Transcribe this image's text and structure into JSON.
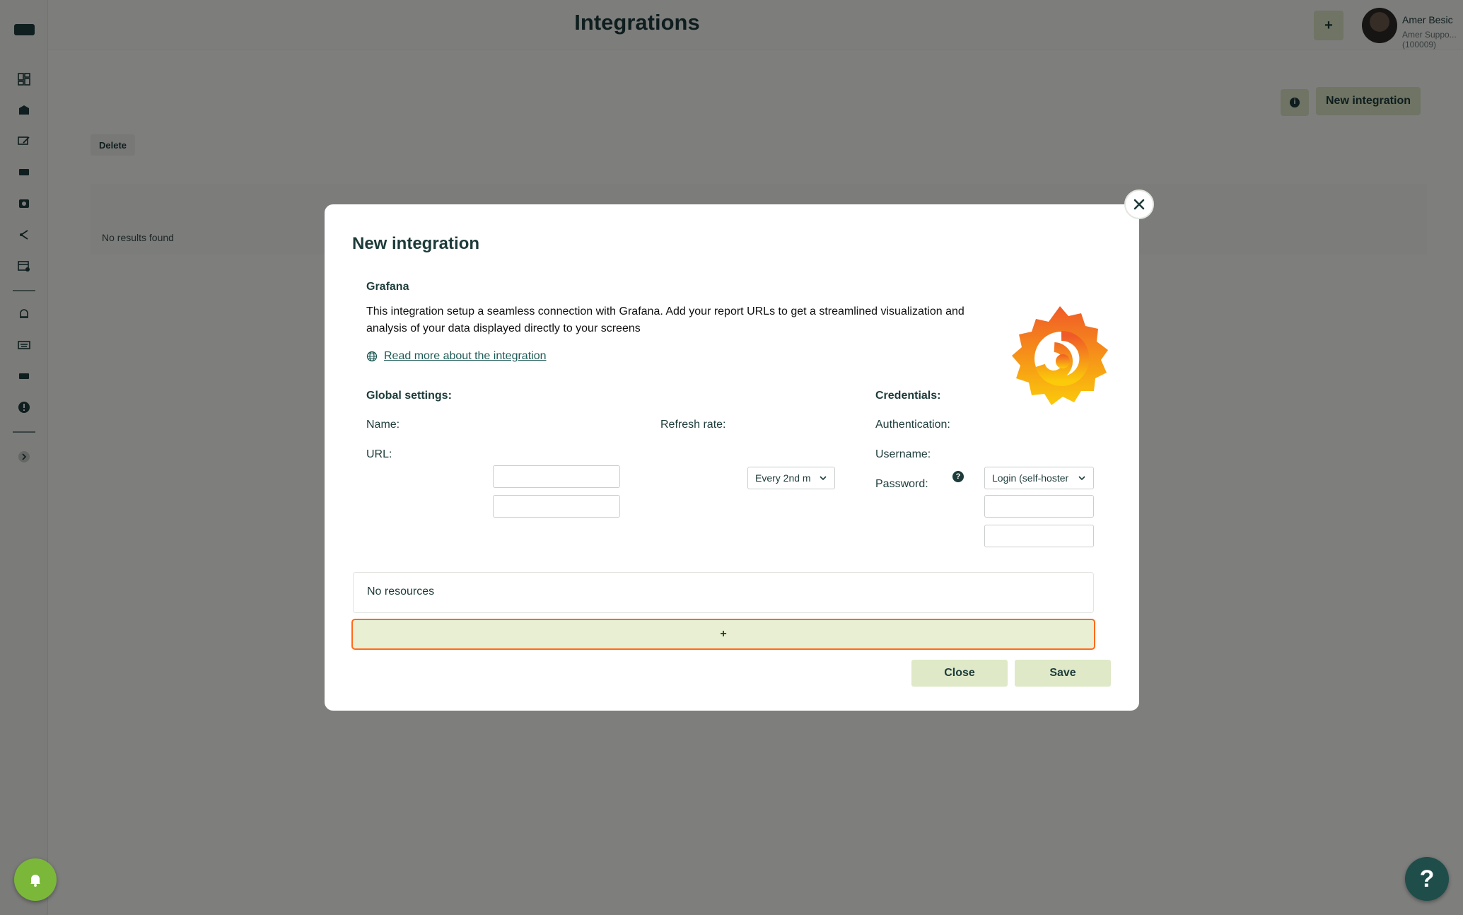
{
  "header": {
    "title": "Integrations",
    "add_label": "+",
    "user_name": "Amer Besic",
    "user_sub": "Amer Suppo...(100009)"
  },
  "sidebar": {
    "icons": [
      "dashboard-icon",
      "media-icon",
      "edit-screen-icon",
      "display-icon",
      "playlist-icon",
      "share-icon",
      "schedule-icon",
      "alarm-icon",
      "keyboard-icon",
      "device-icon",
      "alert-icon",
      "expand-icon"
    ]
  },
  "main": {
    "info_label": "i",
    "new_integration_label": "New integration",
    "delete_label": "Delete",
    "no_results": "No results found"
  },
  "modal": {
    "title": "New integration",
    "integration_name": "Grafana",
    "description": "This integration setup a seamless connection with Grafana. Add your report URLs to get a streamlined visualization and analysis of your data displayed directly to your screens",
    "read_more": "Read more about the integration",
    "global_settings": {
      "heading": "Global settings:",
      "name_label": "Name:",
      "name_value": "",
      "url_label": "URL:",
      "url_value": "",
      "refresh_label": "Refresh rate:",
      "refresh_value": "Every 2nd m"
    },
    "credentials": {
      "heading": "Credentials:",
      "auth_label": "Authentication:",
      "auth_value": "Login (self-hoster",
      "help_label": "?",
      "username_label": "Username:",
      "username_value": "",
      "password_label": "Password:",
      "password_value": ""
    },
    "resources_empty": "No resources",
    "add_resource_label": "+",
    "close_label": "Close",
    "save_label": "Save"
  },
  "fab": {
    "help_label": "?"
  },
  "colors": {
    "primary_dark": "#1d3b3a",
    "accent_light": "#dfe9c8",
    "focus_outline": "#ff6a1a",
    "notification_green": "#7bb83a"
  }
}
